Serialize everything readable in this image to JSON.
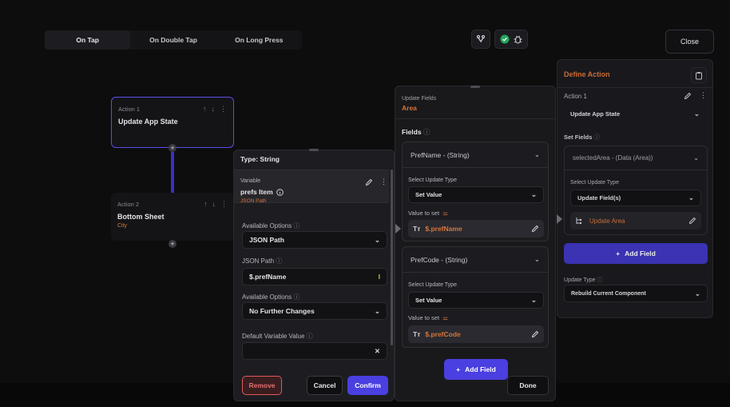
{
  "tabs": [
    "On Tap",
    "On Double Tap",
    "On Long Press"
  ],
  "close_label": "Close",
  "actions": [
    {
      "label": "Action 1",
      "title": "Update App State",
      "sub": ""
    },
    {
      "label": "Action 2",
      "title": "Bottom Sheet",
      "sub": "City"
    }
  ],
  "var_panel": {
    "header": "Type: String",
    "var_label": "Variable",
    "var_name": "prefs Item",
    "var_sub": "JSON Path",
    "avail1_label": "Available Options",
    "avail1_value": "JSON Path",
    "json_label": "JSON Path",
    "json_value": "$.prefName",
    "avail2_label": "Available Options",
    "avail2_value": "No Further Changes",
    "default_label": "Default Variable Value",
    "remove": "Remove",
    "cancel": "Cancel",
    "confirm": "Confirm"
  },
  "update_panel": {
    "title": "Update Fields",
    "sub": "Area",
    "fields_label": "Fields",
    "fields": [
      {
        "name": "PrefName - (String)",
        "type_label": "Select Update Type",
        "type_value": "Set Value",
        "value_label": "Value to set",
        "value": "$.prefName"
      },
      {
        "name": "PrefCode - (String)",
        "type_label": "Select Update Type",
        "type_value": "Set Value",
        "value_label": "Value to set",
        "value": "$.prefCode"
      }
    ],
    "add_field": "Add Field",
    "done": "Done"
  },
  "define_panel": {
    "title": "Define Action",
    "action_label": "Action 1",
    "action_value": "Update App State",
    "set_fields_label": "Set Fields",
    "set_field_value": "selectedArea - (Data (Area))",
    "update_type_label": "Select Update Type",
    "update_type_value": "Update Field(s)",
    "update_area": "Update Area",
    "add_field": "Add Field",
    "update_type2_label": "Update Type",
    "update_type2_value": "Rebuild Current Component"
  },
  "colors": {
    "accent": "#4a3fe0",
    "orange": "#d8743a",
    "remove": "#e05a5a"
  }
}
